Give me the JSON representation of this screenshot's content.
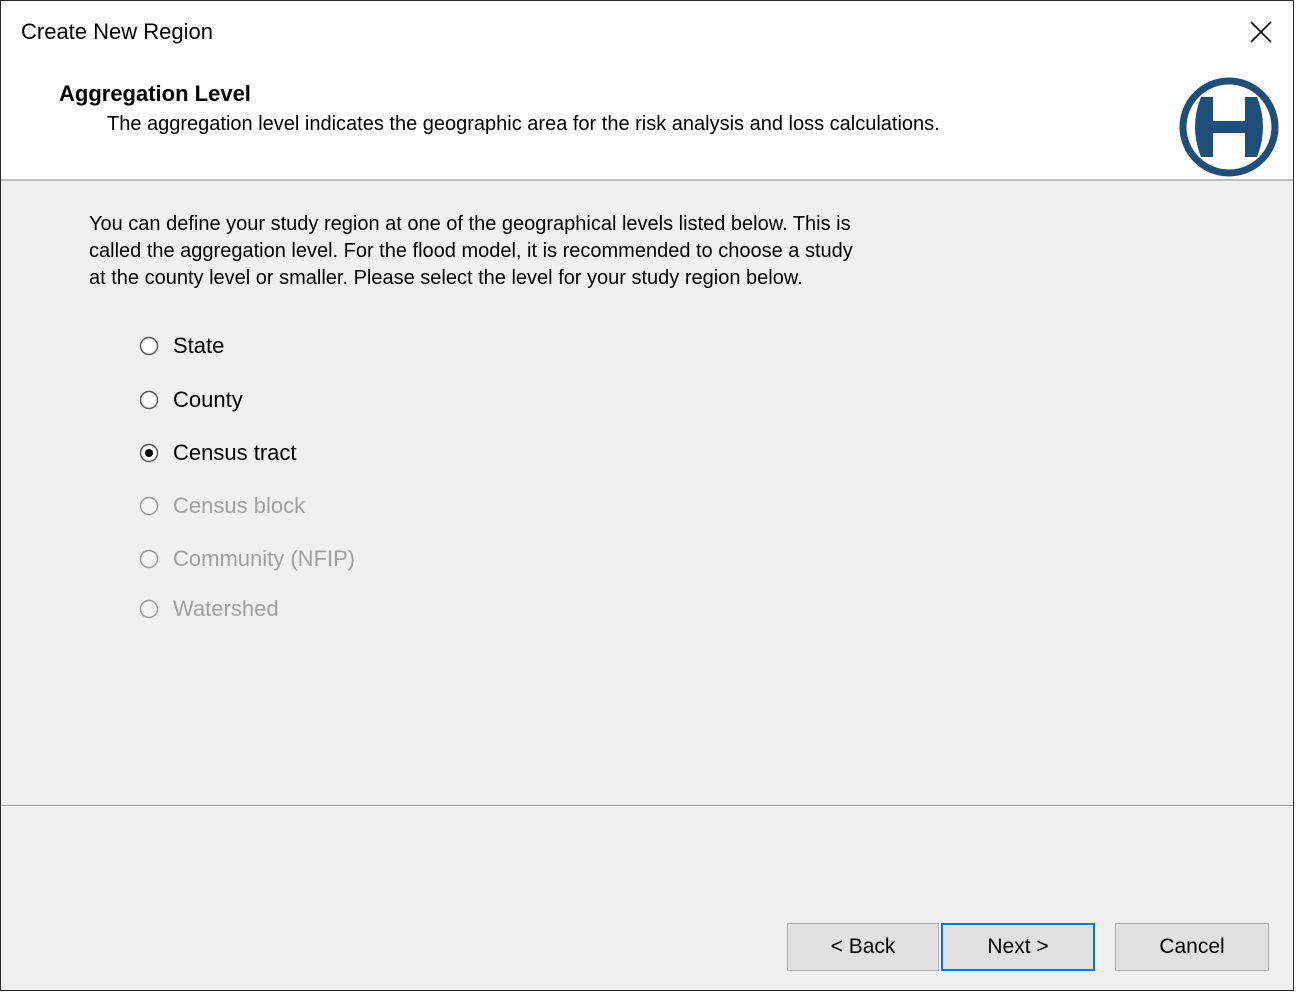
{
  "window": {
    "title": "Create New Region",
    "close_icon": "close-x-icon"
  },
  "header": {
    "title": "Aggregation Level",
    "subtitle": "The aggregation level indicates the geographic area for the risk analysis and loss calculations.",
    "logo_icon": "hazus-h-logo-icon",
    "logo_color": "#1f4e79"
  },
  "intro": {
    "line1": "You can define your study region at one of the geographical levels listed below. This is",
    "line2": "called the aggregation level. For the flood model, it is recommended to choose a study",
    "line3": "at the county level or smaller. Please select the level for your study region below."
  },
  "aggregation_options": [
    {
      "label": "State",
      "selected": false,
      "enabled": true
    },
    {
      "label": "County",
      "selected": false,
      "enabled": true
    },
    {
      "label": "Census tract",
      "selected": true,
      "enabled": true
    },
    {
      "label": "Census block",
      "selected": false,
      "enabled": false
    },
    {
      "label": "Community (NFIP)",
      "selected": false,
      "enabled": false
    },
    {
      "label": "Watershed",
      "selected": false,
      "enabled": false
    }
  ],
  "buttons": {
    "back": "< Back",
    "next": "Next >",
    "cancel": "Cancel"
  },
  "colors": {
    "dialog_bg": "#f0f0f0",
    "header_bg": "#ffffff",
    "disabled_text": "#a0a0a0",
    "focus_border": "#0078d7"
  }
}
